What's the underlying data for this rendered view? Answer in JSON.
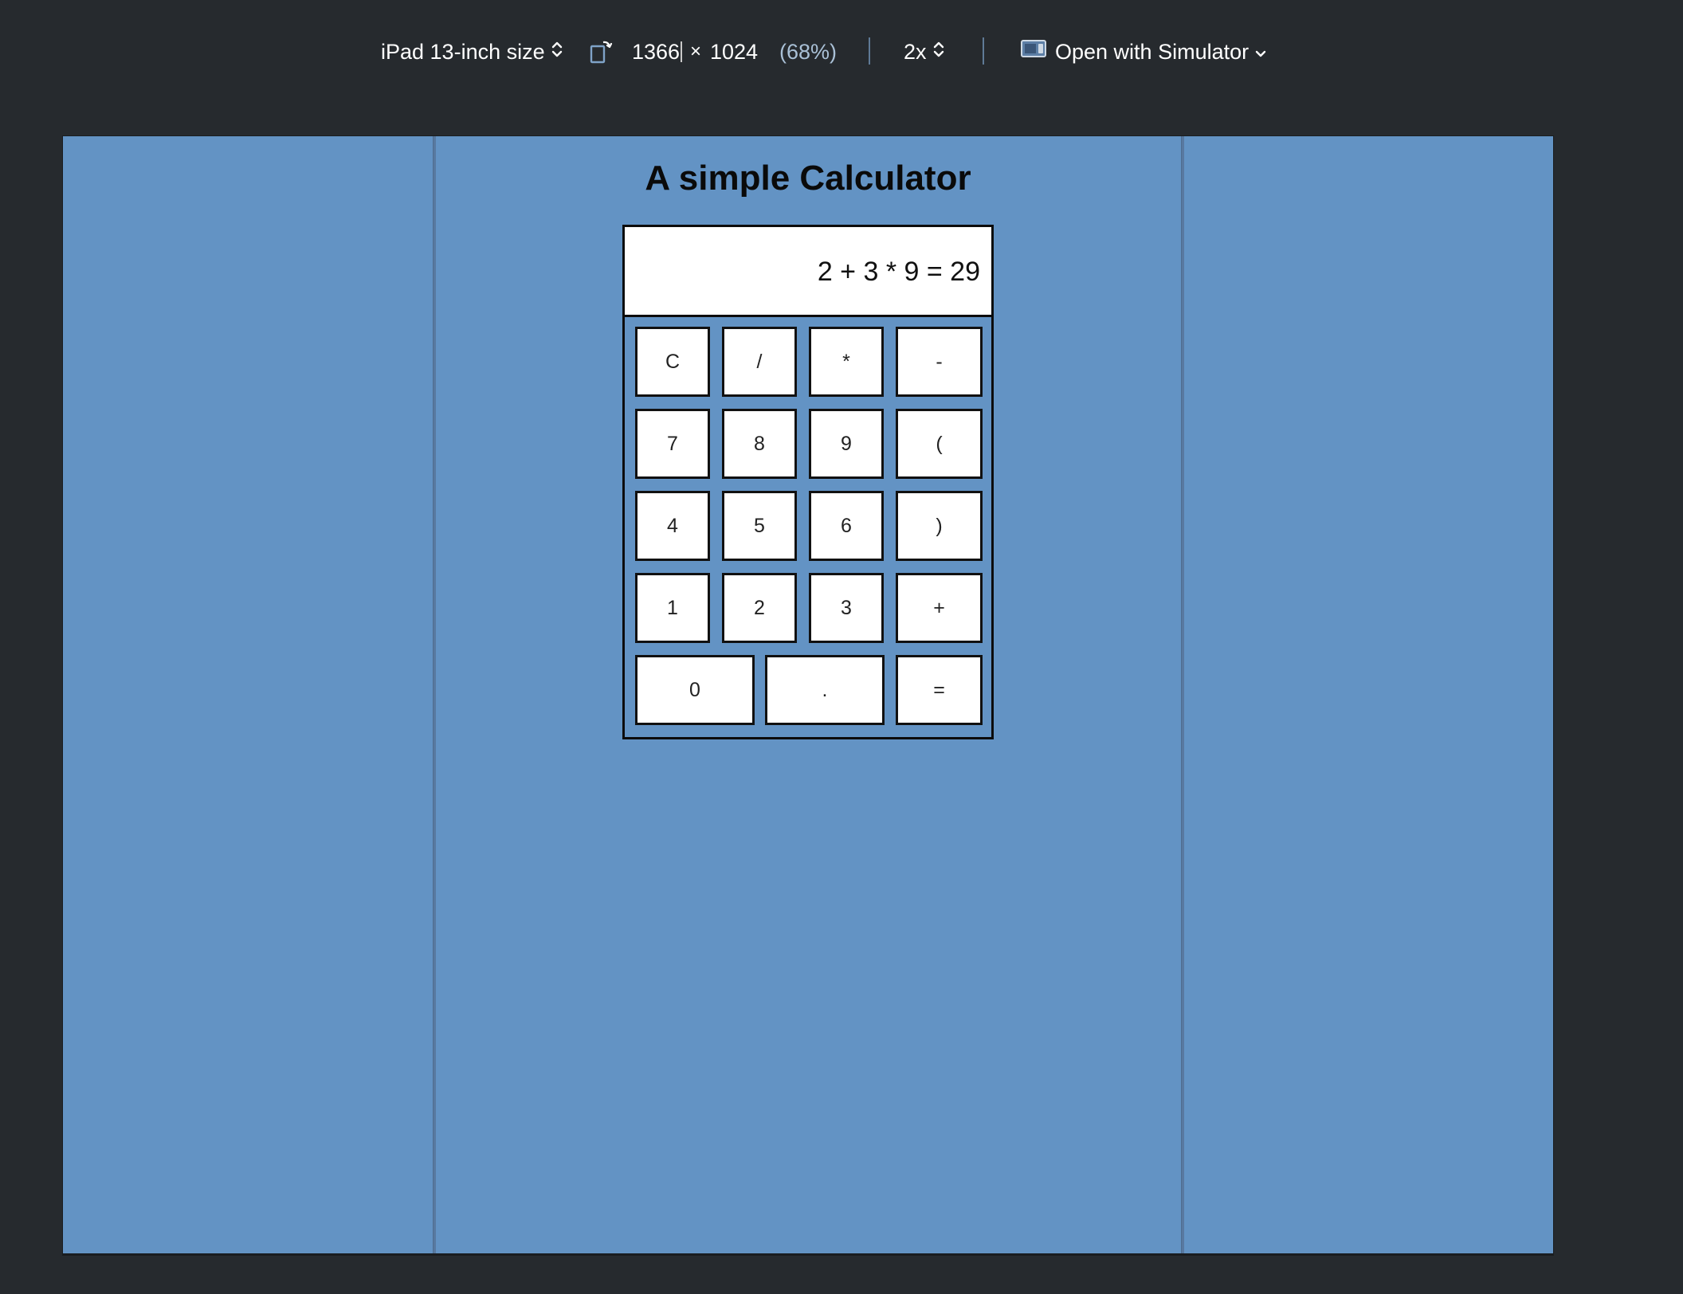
{
  "toolbar": {
    "device_label": "iPad 13-inch size",
    "width_value": "1366",
    "times_symbol": "×",
    "height_value": "1024",
    "zoom_percent": "(68%)",
    "scale_value": "2x",
    "open_with_label": "Open with Simulator",
    "icons": {
      "device_chevron": "chevron-up-down-icon",
      "rotate": "rotate-device-icon",
      "scale_chevron": "chevron-up-down-icon",
      "simulator": "simulator-icon",
      "open_chevron": "chevron-down-icon"
    }
  },
  "page": {
    "title": "A simple Calculator",
    "background_color": "#6393c4"
  },
  "calculator": {
    "display": "2 + 3 * 9 = 29",
    "keys": [
      {
        "label": "C",
        "name": "key-clear"
      },
      {
        "label": "/",
        "name": "key-divide"
      },
      {
        "label": "*",
        "name": "key-multiply"
      },
      {
        "label": "-",
        "name": "key-subtract"
      },
      {
        "label": "7",
        "name": "key-7"
      },
      {
        "label": "8",
        "name": "key-8"
      },
      {
        "label": "9",
        "name": "key-9"
      },
      {
        "label": "(",
        "name": "key-open-paren"
      },
      {
        "label": "4",
        "name": "key-4"
      },
      {
        "label": "5",
        "name": "key-5"
      },
      {
        "label": "6",
        "name": "key-6"
      },
      {
        "label": ")",
        "name": "key-close-paren"
      },
      {
        "label": "1",
        "name": "key-1"
      },
      {
        "label": "2",
        "name": "key-2"
      },
      {
        "label": "3",
        "name": "key-3"
      },
      {
        "label": "+",
        "name": "key-add"
      },
      {
        "label": "0",
        "name": "key-0"
      },
      {
        "label": ".",
        "name": "key-decimal"
      },
      {
        "label": "=",
        "name": "key-equals"
      }
    ]
  }
}
